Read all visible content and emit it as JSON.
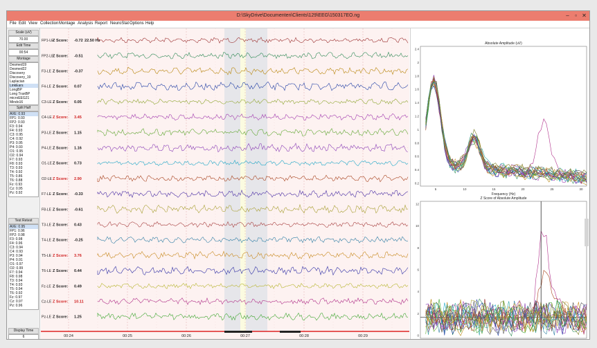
{
  "window": {
    "title": "D:\\SkyDrive\\Documenten\\Clients\\129\\EEG\\150317EO.ng",
    "minimize_glyph": "–",
    "maximize_glyph": "▫",
    "close_glyph": "✕"
  },
  "menu": [
    "File",
    "Edit",
    "View",
    "Collection",
    "Montage",
    "Analysis",
    "Report",
    "NeuroStat",
    "Options",
    "Help"
  ],
  "sidebar": {
    "scale_label": "Scale (uV)",
    "scale_value": "70.00",
    "edit_time_label": "Edit Time",
    "edit_time_value": "00:54",
    "montage_label": "Montage",
    "montages": [
      "Desmed19",
      "Desmed22",
      "Discovery",
      "Discovery_19",
      "Laplacian",
      "LinkEars",
      "LongBP",
      "Long TranBP",
      "microEEG21",
      "Mindo16"
    ],
    "montage_selected": "LinkEars",
    "split_half_label": "Split Half",
    "split_half": [
      "AVE: 0.93",
      "FP1: 0.93",
      "FP2: 0.93",
      "F3: 0.94",
      "F4: 0.93",
      "C3: 0.95",
      "C4: 0.92",
      "P3: 0.95",
      "P4: 0.93",
      "O1: 0.95",
      "O2: 0.94",
      "F7: 0.93",
      "F8: 0.93",
      "T3: 0.93",
      "T4: 0.92",
      "T5: 0.86",
      "T6: 0.88",
      "Fz: 0.93",
      "Cz: 0.95",
      "Pz: 0.92"
    ],
    "test_retest_label": "Test Retest",
    "test_retest": [
      "AVE: 0.95",
      "FP1: 0.96",
      "FP2: 0.98",
      "F3: 0.98",
      "F4: 0.96",
      "C3: 0.94",
      "C4: 0.93",
      "P3: 0.94",
      "P4: 0.91",
      "O1: 0.97",
      "O2: 0.99",
      "F7: 0.94",
      "F8: 0.98",
      "T3: 0.94",
      "T4: 0.93",
      "T5: 0.94",
      "T6: 0.92",
      "Fz: 0.97",
      "Cz: 0.97",
      "Pz: 0.96"
    ],
    "display_time_label": "Display Time",
    "display_time_value": "6"
  },
  "eeg": {
    "zscore_prefix": "Z Score:",
    "freq_label": "22.50 Hz",
    "time_ticks": [
      "00:24",
      "00:25",
      "00:26",
      "00:27",
      "00:28",
      "00:29"
    ],
    "channels": [
      {
        "label": "FP1-LE",
        "z": "-0.72",
        "color": "#9b2f2f",
        "z_red": false
      },
      {
        "label": "FP2-LE",
        "z": "-0.51",
        "color": "#2e8b57",
        "z_red": false
      },
      {
        "label": "F3-LE",
        "z": "-0.37",
        "color": "#b8860b",
        "z_red": false
      },
      {
        "label": "F4-LE",
        "z": "0.07",
        "color": "#1f3fa6",
        "z_red": false
      },
      {
        "label": "C3-LE",
        "z": "0.05",
        "color": "#8fa832",
        "z_red": false
      },
      {
        "label": "C4-LE",
        "z": "3.45",
        "color": "#a23cb0",
        "z_red": true
      },
      {
        "label": "P3-LE",
        "z": "1.15",
        "color": "#5fa832",
        "z_red": false
      },
      {
        "label": "P4-LE",
        "z": "1.16",
        "color": "#8a3fb8",
        "z_red": false
      },
      {
        "label": "O1-LE",
        "z": "0.73",
        "color": "#1ea8c8",
        "z_red": false
      },
      {
        "label": "O2-LE",
        "z": "2.90",
        "color": "#a8431e",
        "z_red": true
      },
      {
        "label": "F7-LE",
        "z": "-0.33",
        "color": "#4a2fa6",
        "z_red": false
      },
      {
        "label": "F8-LE",
        "z": "-0.61",
        "color": "#a8a032",
        "z_red": false
      },
      {
        "label": "T3-LE",
        "z": "0.43",
        "color": "#a84040",
        "z_red": false
      },
      {
        "label": "T4-LE",
        "z": "-0.25",
        "color": "#2f7fa6",
        "z_red": false
      },
      {
        "label": "T5-LE",
        "z": "3.76",
        "color": "#c88a1e",
        "z_red": true
      },
      {
        "label": "T6-LE",
        "z": "0.44",
        "color": "#2f2fa6",
        "z_red": false
      },
      {
        "label": "Fz-LE",
        "z": "0.49",
        "color": "#b8b832",
        "z_red": false
      },
      {
        "label": "Cz-LE",
        "z": "10.11",
        "color": "#b02f8a",
        "z_red": true
      },
      {
        "label": "Pz-LE",
        "z": "1.25",
        "color": "#3fa832",
        "z_red": false
      }
    ]
  },
  "plots": {
    "top": {
      "title": "Absolute Amplitude (uV)",
      "xlabel": "Frequency (Hz)",
      "y_ticks": [
        "2.4",
        "2",
        "1.8",
        "1.6",
        "1.4",
        "1.2",
        "1",
        "0.8",
        "0.6",
        "0.4",
        "0.2"
      ],
      "x_ticks": [
        "5",
        "10",
        "15",
        "20",
        "25",
        "30"
      ]
    },
    "bottom": {
      "title": "Z Score of Absolute Amplitude",
      "xlabel": "Frequency (Hz)",
      "y_ticks": [
        "12",
        "10",
        "8",
        "6",
        "4",
        "2",
        "0"
      ],
      "x_ticks": [
        "5",
        "10",
        "15",
        "20",
        "25",
        "30"
      ],
      "cursor_hz": 22.5
    },
    "series_colors": [
      "#b8860b",
      "#2e8b57",
      "#1f3fa6",
      "#a23cb0",
      "#5fa832",
      "#1ea8c8",
      "#a8431e",
      "#4a2fa6",
      "#a8a032",
      "#2f7fa6",
      "#c88a1e",
      "#b02f8a",
      "#3fa832",
      "#9b2f2f",
      "#8a3fb8",
      "#555555",
      "#d0a040",
      "#2fa6a0",
      "#7a7a20"
    ],
    "highlight_color": "#b0307a"
  }
}
